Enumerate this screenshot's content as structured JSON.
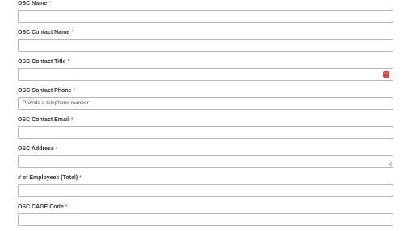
{
  "form": {
    "required_marker": "*",
    "fields": [
      {
        "label": "OSC Name",
        "value": "",
        "placeholder": ""
      },
      {
        "label": "OSC Contact Name",
        "value": "",
        "placeholder": ""
      },
      {
        "label": "OSC Contact Title",
        "value": "",
        "placeholder": "",
        "icon": "password-manager-icon"
      },
      {
        "label": "OSC Contact Phone",
        "value": "",
        "placeholder": "Provide a telephone number"
      },
      {
        "label": "OSC Contact Email",
        "value": "",
        "placeholder": ""
      },
      {
        "label": "OSC Address",
        "value": "",
        "placeholder": "",
        "icon": "resize-handle-icon"
      },
      {
        "label": "# of Employees (Total)",
        "value": "",
        "placeholder": ""
      },
      {
        "label": "OSC CAGE Code",
        "value": "",
        "placeholder": ""
      }
    ]
  },
  "colors": {
    "required": "#c0392b",
    "border": "#b8b8b8",
    "autofill_badge": "#e0433b"
  }
}
